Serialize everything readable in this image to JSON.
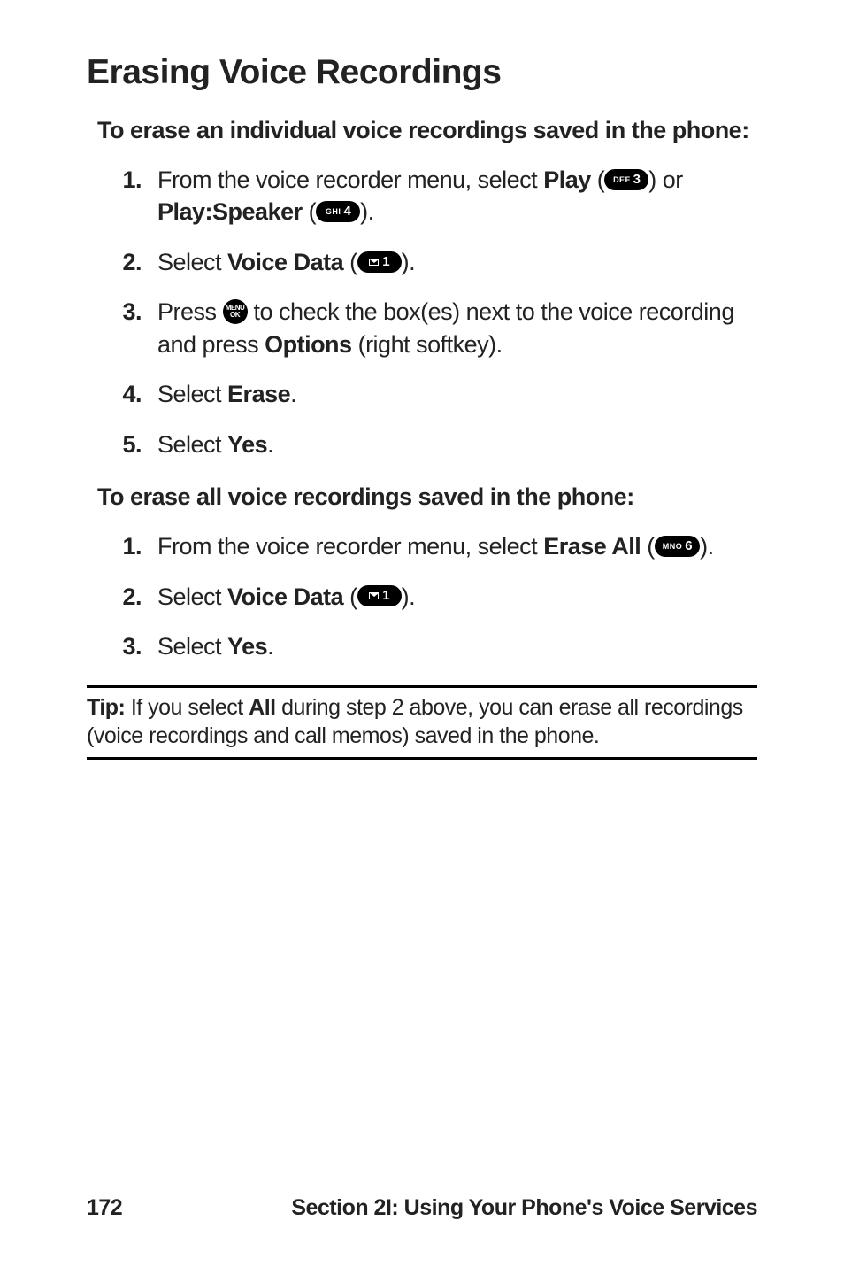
{
  "title": "Erasing Voice Recordings",
  "sections": [
    {
      "heading": "To erase an individual voice recordings saved in the phone:",
      "steps": [
        {
          "num": "1.",
          "pre": "From the voice recorder menu, select ",
          "bold1": "Play",
          "mid1": " (",
          "key1": {
            "tiny": "DEF",
            "big": "3"
          },
          "mid2": ") or ",
          "bold2": "Play:Speaker",
          "mid3": " (",
          "key2": {
            "tiny": "GHI",
            "big": "4"
          },
          "post": ")."
        },
        {
          "num": "2.",
          "pre": "Select ",
          "bold1": "Voice Data",
          "mid1": " (",
          "key1": {
            "mail": true,
            "big": "1"
          },
          "post": ")."
        },
        {
          "num": "3.",
          "pre": "Press ",
          "roundkey": {
            "l1": "MENU",
            "l2": "OK"
          },
          "mid1": " to check the box(es) next to the voice recording and press ",
          "bold1": "Options",
          "post": " (right softkey)."
        },
        {
          "num": "4.",
          "pre": "Select ",
          "bold1": "Erase",
          "post": "."
        },
        {
          "num": "5.",
          "pre": "Select ",
          "bold1": "Yes",
          "post": "."
        }
      ]
    },
    {
      "heading": "To erase all voice recordings saved in the phone:",
      "steps": [
        {
          "num": "1.",
          "pre": "From the voice recorder menu, select ",
          "bold1": "Erase All",
          "mid1": " (",
          "key1": {
            "tiny": "MNO",
            "big": "6"
          },
          "post": ")."
        },
        {
          "num": "2.",
          "pre": "Select ",
          "bold1": "Voice Data",
          "mid1": " (",
          "key1": {
            "mail": true,
            "big": "1"
          },
          "post": ")."
        },
        {
          "num": "3.",
          "pre": "Select ",
          "bold1": "Yes",
          "post": "."
        }
      ]
    }
  ],
  "tip": {
    "label": "Tip:",
    "pre": " If you select ",
    "bold": "All",
    "post": " during step 2 above, you can erase all recordings (voice recordings and call memos) saved in the phone."
  },
  "footer": {
    "page": "172",
    "section": "Section 2I: Using Your Phone's Voice Services"
  }
}
